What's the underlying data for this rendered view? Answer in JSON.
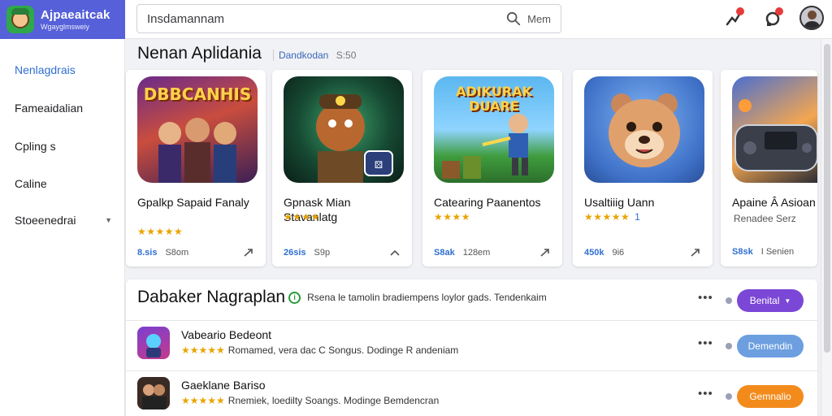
{
  "app": {
    "title": "Ajpaeaitcak",
    "subtitle": "Wgayglmsweiy"
  },
  "search": {
    "value": "Insdamannam",
    "button_label": "Mem"
  },
  "sidebar": {
    "items": [
      {
        "label": "Nenlagdrais",
        "active": true
      },
      {
        "label": "Fameaidalian"
      },
      {
        "label": "Cpling s"
      },
      {
        "label": "Caline"
      },
      {
        "label": "Stoeenedrai",
        "has_caret": true
      }
    ]
  },
  "featured": {
    "title": "Nenan Aplidania",
    "meta": "Dandkodan",
    "meta2": "S:50",
    "cards": [
      {
        "art_text": "DBBCANHIS",
        "name": "Gpalkp Sapaid Fanaly",
        "rating": "★★★★★",
        "rating_sub": "",
        "price": "8.sis",
        "size": "S8om"
      },
      {
        "art_text": "",
        "name": "Gpnask Mian Stavanlatg",
        "rating": "★★★★",
        "rating_sub": "",
        "price": "26sis",
        "size": "S9p"
      },
      {
        "art_text": "ADIKURAK DUARE",
        "name": "Catearing Paanentos",
        "rating": "★★★★",
        "rating_sub": "",
        "price": "S8ak",
        "size": "128em"
      },
      {
        "art_text": "",
        "name": "Usaltiiig Uann",
        "rating": "★★★★★",
        "rating_sub": "1",
        "price": "450k",
        "size": "9i6"
      },
      {
        "art_text": "",
        "name": "Apaine Â Asioan",
        "rating": "",
        "rating_sub": "Renadee Serz",
        "price": "S8sk",
        "size": "I Senien"
      }
    ]
  },
  "list": {
    "title": "Dabaker Nagraplan",
    "description": "Rsena le tamolin bradiempens loylor gads. Tendenkaim",
    "header_button": "Benital",
    "rows": [
      {
        "name": "Vabeario Bedeont",
        "stars": "★★★★★",
        "text": "Romamed, vera dac C Songus.  Dodinge R andeniam",
        "button": "Demendin"
      },
      {
        "name": "Gaeklane Bariso",
        "stars": "★★★★★",
        "text": "Rnemiek, loedilty Soangs. Modinge Bemdencran",
        "button": "Gemnalio"
      }
    ]
  },
  "colors": {
    "brand": "#5560d9",
    "accent_blue": "#2f6fd1",
    "star": "#e9a400",
    "pill_purple": "#7b47d6",
    "pill_blue": "#6d9fe0",
    "pill_orange": "#f38b1c"
  },
  "icons": {
    "search": "search-icon",
    "notifications": "notification-icon",
    "messages": "chat-icon",
    "profile": "avatar",
    "trend": "trend-icon",
    "more": "more-icon"
  }
}
